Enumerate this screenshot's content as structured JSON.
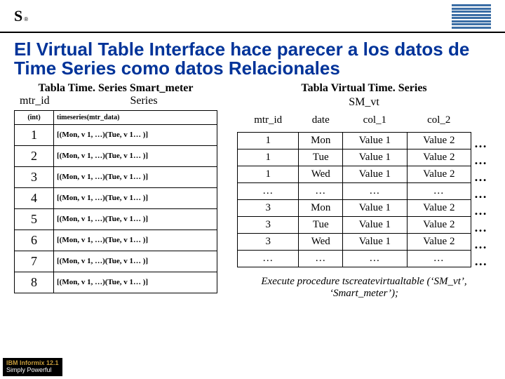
{
  "header": {
    "informix_letter": "S",
    "informix_reg": "®"
  },
  "title": "El Virtual Table Interface hace parecer a los datos de Time Series como datos Relacionales",
  "left": {
    "title": "Tabla Time. Series Smart_meter",
    "col1_hdr": "mtr_id",
    "col2_hdr": "Series",
    "sub_col1": "(int)",
    "sub_col2": "timeseries(mtr_data)",
    "rows": [
      {
        "id": "1",
        "ser": "[(Mon, v 1, …)(Tue, v 1… )]"
      },
      {
        "id": "2",
        "ser": "[(Mon, v 1, …)(Tue, v 1… )]"
      },
      {
        "id": "3",
        "ser": "[(Mon, v 1, …)(Tue, v 1… )]"
      },
      {
        "id": "4",
        "ser": "[(Mon, v 1, …)(Tue, v 1… )]"
      },
      {
        "id": "5",
        "ser": "[(Mon, v 1, …)(Tue, v 1… )]"
      },
      {
        "id": "6",
        "ser": "[(Mon, v 1, …)(Tue, v 1… )]"
      },
      {
        "id": "7",
        "ser": "[(Mon, v 1, …)(Tue, v 1… )]"
      },
      {
        "id": "8",
        "ser": "[(Mon, v 1, …)(Tue, v 1… )]"
      }
    ]
  },
  "right": {
    "title": "Tabla Virtual Time. Series",
    "subtitle": "SM_vt",
    "headers": [
      "mtr_id",
      "date",
      "col_1",
      "col_2"
    ],
    "rows": [
      {
        "id": "1",
        "date": "Mon",
        "c1": "Value 1",
        "c2": "Value 2",
        "e": "…"
      },
      {
        "id": "1",
        "date": "Tue",
        "c1": "Value 1",
        "c2": "Value 2",
        "e": "…"
      },
      {
        "id": "1",
        "date": "Wed",
        "c1": "Value 1",
        "c2": "Value 2",
        "e": "…"
      },
      {
        "id": "…",
        "date": "…",
        "c1": "…",
        "c2": "…",
        "e": "…"
      },
      {
        "id": "3",
        "date": "Mon",
        "c1": "Value 1",
        "c2": "Value 2",
        "e": "…"
      },
      {
        "id": "3",
        "date": "Tue",
        "c1": "Value 1",
        "c2": "Value 2",
        "e": "…"
      },
      {
        "id": "3",
        "date": "Wed",
        "c1": "Value 1",
        "c2": "Value 2",
        "e": "…"
      },
      {
        "id": "…",
        "date": "…",
        "c1": "…",
        "c2": "…",
        "e": "…"
      }
    ],
    "exec": "Execute procedure tscreatevirtualtable (‘SM_vt’, ‘Smart_meter’);"
  },
  "footer": {
    "line1": "IBM Informix 12.1",
    "line2": "Simply Powerful"
  }
}
